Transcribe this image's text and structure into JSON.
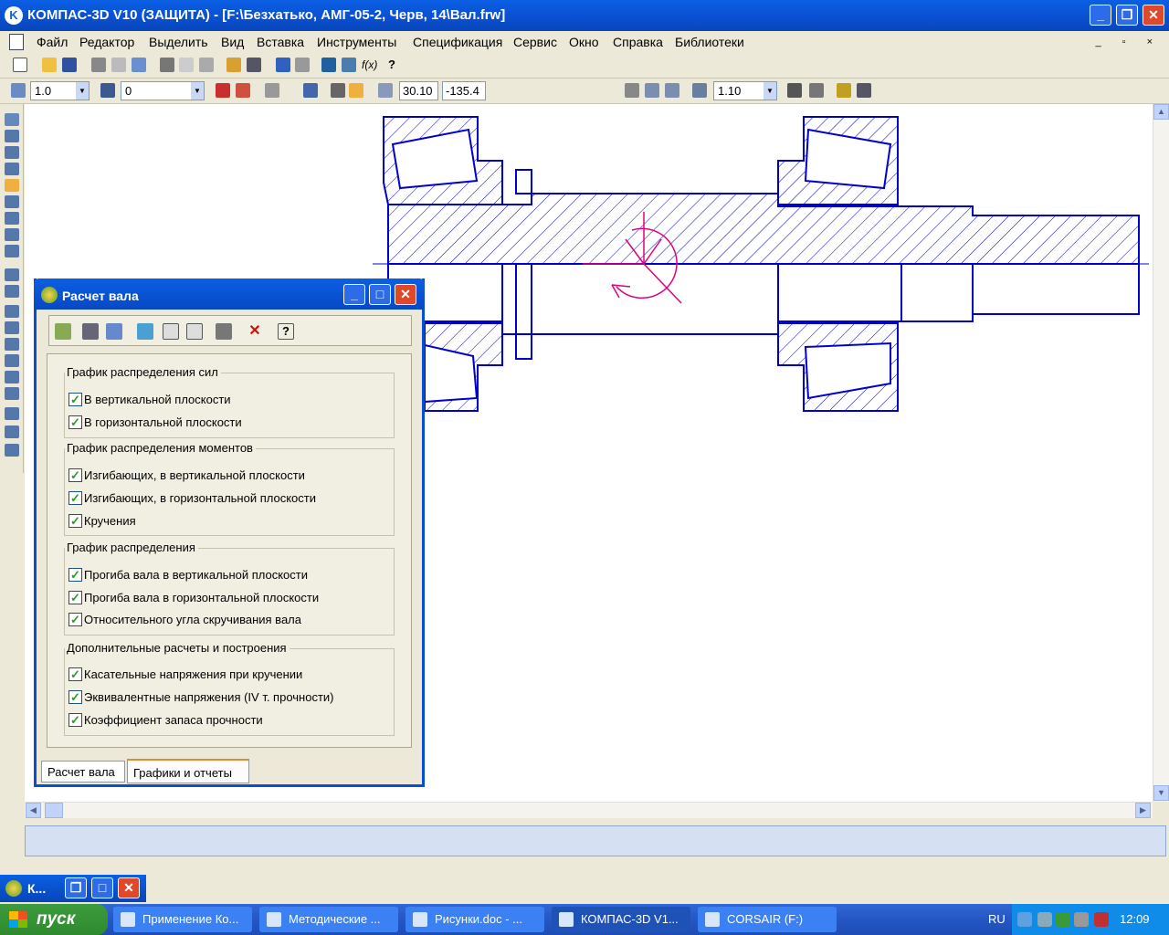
{
  "window": {
    "title": "КОМПАС-3D V10 (ЗАЩИТА) - [F:\\Безхатько, АМГ-05-2, Черв, 14\\Вал.frw]",
    "minimize": "_",
    "maximize": "❐",
    "close": "✕"
  },
  "menu": [
    "Файл",
    "Редактор",
    "Выделить",
    "Вид",
    "Вставка",
    "Инструменты",
    "Спецификация",
    "Сервис",
    "Окно",
    "Справка",
    "Библиотеки"
  ],
  "mdi_buttons": "_ ▫ ×",
  "toolbar2": {
    "step": "1.0",
    "layer": "0",
    "x_coord": "30.10",
    "y_coord": "-135.4",
    "zoom": "1.10"
  },
  "dialog": {
    "title": "Расчет вала",
    "groups": [
      {
        "title": "График распределения сил",
        "items": [
          "В вертикальной плоскости",
          "В горизонтальной плоскости"
        ]
      },
      {
        "title": "График распределения моментов",
        "items": [
          "Изгибающих, в вертикальной плоскости",
          "Изгибающих, в горизонтальной плоскости",
          "Кручения"
        ]
      },
      {
        "title": "График распределения",
        "items": [
          "Прогиба вала в вертикальной плоскости",
          "Прогиба вала в горизонтальной плоскости",
          "Относительного угла скручивания вала"
        ]
      },
      {
        "title": "Дополнительные расчеты и построения",
        "items": [
          "Касательные напряжения при кручении",
          "Эквивалентные напряжения (IV т. прочности)",
          "Коэффициент запаса прочности"
        ]
      }
    ],
    "tabs": [
      "Расчет вала",
      "Графики и отчеты"
    ],
    "checkmark": "✓"
  },
  "minimized_window": {
    "label": "К..."
  },
  "taskbar": {
    "start": "пуск",
    "tasks": [
      "Применение Ко...",
      "Методические ...",
      "Рисунки.doc - ...",
      "КОМПАС-3D V1...",
      "CORSAIR (F:)"
    ],
    "lang": "RU",
    "clock": "12:09"
  },
  "colors": {
    "drawing_line": "#0000cc",
    "marker": "#e0007a"
  }
}
